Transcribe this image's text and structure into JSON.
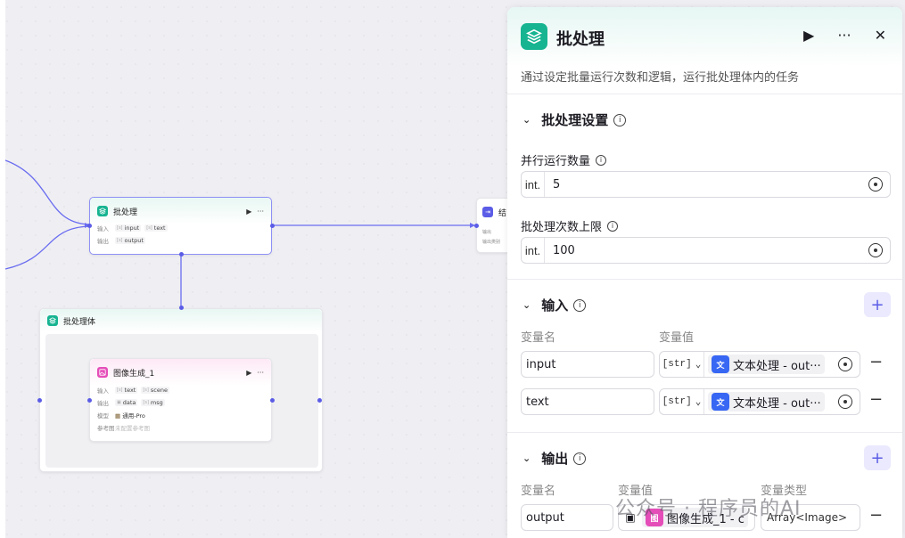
{
  "canvas": {
    "batch_node": {
      "title": "批处理",
      "input_label": "输入",
      "output_label": "输出",
      "inputs": [
        "input",
        "text"
      ],
      "outputs": [
        "output"
      ]
    },
    "end_node": {
      "title": "结",
      "row1": "输出",
      "row2": "输出类别"
    },
    "batch_body": {
      "title": "批处理体"
    },
    "image_node": {
      "title": "图像生成_1",
      "input_label": "输入",
      "output_label": "输出",
      "model_label": "模型",
      "ref_label": "参考图",
      "inputs": [
        "text",
        "scene"
      ],
      "outputs": [
        "data",
        "msg"
      ],
      "model": "通用-Pro",
      "ref": "未配置参考图"
    }
  },
  "panel": {
    "title": "批处理",
    "description": "通过设定批量运行次数和逻辑，运行批处理体内的任务",
    "settings_title": "批处理设置",
    "parallel_label": "并行运行数量",
    "parallel_prefix": "int.",
    "parallel_value": "5",
    "limit_label": "批处理次数上限",
    "limit_prefix": "int.",
    "limit_value": "100",
    "input_title": "输入",
    "col_name": "变量名",
    "col_value": "变量值",
    "inputs": [
      {
        "name": "input",
        "type": "[str]",
        "ref": "文本处理 - out···"
      },
      {
        "name": "text",
        "type": "[str]",
        "ref": "文本处理 - out···"
      }
    ],
    "output_title": "输出",
    "col_type": "变量类型",
    "output": {
      "name": "output",
      "ref": "图像生成_1 - c",
      "type": "Array<Image>"
    }
  },
  "watermark": "公众号 · 程序员的AI",
  "colors": {
    "accent": "#5b5ce6",
    "batch": "#17b491",
    "text_ref": "#3867f4",
    "image": "#e54db9"
  }
}
